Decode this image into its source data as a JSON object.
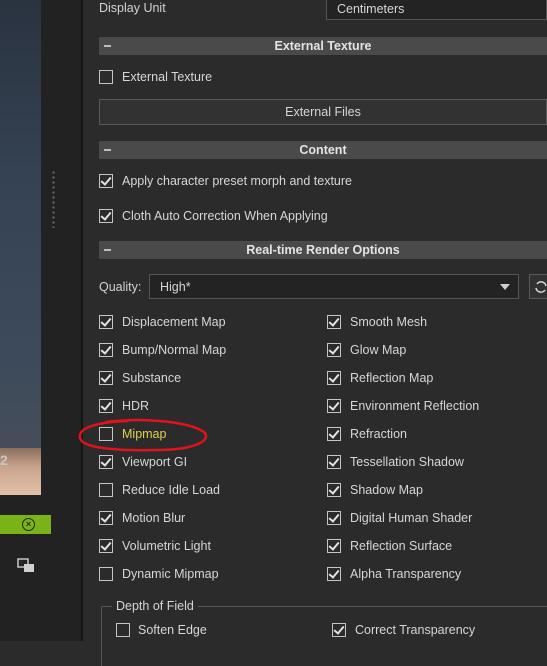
{
  "display_unit": {
    "label": "Display Unit",
    "value": "Centimeters"
  },
  "external_texture": {
    "header": "External Texture",
    "checkbox_label": "External Texture",
    "checked": false,
    "files_button": "External Files"
  },
  "content": {
    "header": "Content",
    "apply_preset": {
      "label": "Apply character preset morph and texture",
      "checked": true
    },
    "cloth_correction": {
      "label": "Cloth Auto Correction When Applying",
      "checked": true
    }
  },
  "render_options": {
    "header": "Real-time Render Options",
    "quality_label": "Quality:",
    "quality_value": "High*",
    "left_column": [
      {
        "label": "Displacement Map",
        "checked": true
      },
      {
        "label": "Bump/Normal Map",
        "checked": true
      },
      {
        "label": "Substance",
        "checked": true
      },
      {
        "label": "HDR",
        "checked": true
      },
      {
        "label": "Mipmap",
        "checked": false
      },
      {
        "label": "Viewport GI",
        "checked": true
      },
      {
        "label": "Reduce Idle Load",
        "checked": false
      },
      {
        "label": "Motion Blur",
        "checked": true
      },
      {
        "label": "Volumetric Light",
        "checked": true
      },
      {
        "label": "Dynamic Mipmap",
        "checked": false
      }
    ],
    "right_column": [
      {
        "label": "Smooth Mesh",
        "checked": true
      },
      {
        "label": "Glow Map",
        "checked": true
      },
      {
        "label": "Reflection Map",
        "checked": true
      },
      {
        "label": "Environment Reflection",
        "checked": true
      },
      {
        "label": "Refraction",
        "checked": true
      },
      {
        "label": "Tessellation Shadow",
        "checked": true
      },
      {
        "label": "Shadow Map",
        "checked": true
      },
      {
        "label": "Digital Human Shader",
        "checked": true
      },
      {
        "label": "Reflection Surface",
        "checked": true
      },
      {
        "label": "Alpha Transparency",
        "checked": true
      }
    ]
  },
  "depth_of_field": {
    "label": "Depth of Field",
    "soften_edge": {
      "label": "Soften Edge",
      "checked": false
    },
    "correct_transparency": {
      "label": "Correct Transparency",
      "checked": true
    }
  },
  "viewport_overlay_number": "2",
  "colors": {
    "accent_green": "#7ab317",
    "annotation_red": "#e0121b",
    "mipmap_highlight": "#d9d24a"
  }
}
